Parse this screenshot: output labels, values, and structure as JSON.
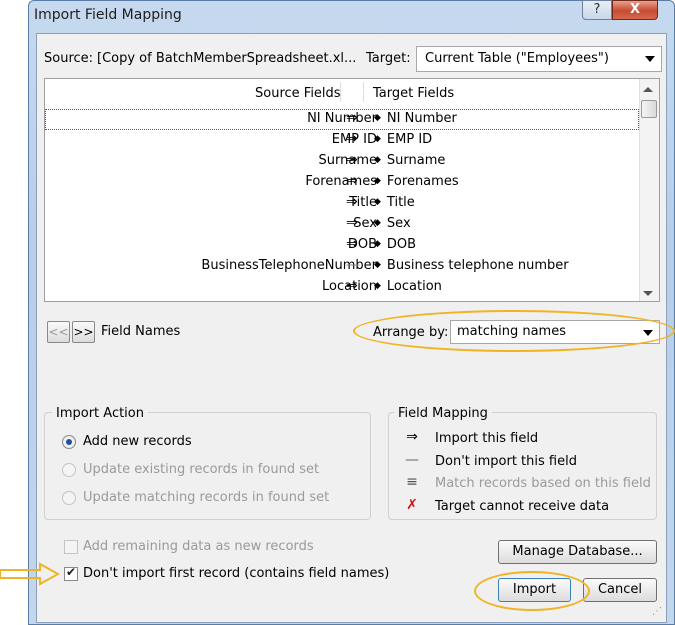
{
  "window": {
    "title": "Import Field Mapping",
    "help_glyph": "?",
    "close_glyph": "X"
  },
  "source": {
    "label": "Source:",
    "value": "[Copy of BatchMemberSpreadsheet.xl..."
  },
  "target": {
    "label": "Target:",
    "value": "Current Table (\"Employees\")"
  },
  "mapping_table": {
    "headers": {
      "source": "Source Fields",
      "target": "Target Fields"
    },
    "rows": [
      {
        "source": "NI Number",
        "symbol": "⇒",
        "target": "NI Number"
      },
      {
        "source": "EMP ID",
        "symbol": "⇒",
        "target": "EMP ID"
      },
      {
        "source": "Surname",
        "symbol": "⇒",
        "target": "Surname"
      },
      {
        "source": "Forenames",
        "symbol": "⇒",
        "target": "Forenames"
      },
      {
        "source": "Title",
        "symbol": "⇒",
        "target": "Title"
      },
      {
        "source": "Sex",
        "symbol": "⇒",
        "target": "Sex"
      },
      {
        "source": "DOB",
        "symbol": "⇒",
        "target": "DOB"
      },
      {
        "source": "BusinessTelephoneNumber",
        "symbol": "—",
        "target": "Business telephone number"
      },
      {
        "source": "Location",
        "symbol": "⇒",
        "target": "Location"
      }
    ],
    "updown_glyph": "◆"
  },
  "navigation": {
    "prev": "<<",
    "next": ">>",
    "label": "Field Names"
  },
  "arrange": {
    "label": "Arrange by:",
    "value": "matching names"
  },
  "import_action": {
    "title": "Import Action",
    "options": [
      {
        "label": "Add new records",
        "selected": true,
        "enabled": true
      },
      {
        "label": "Update existing records in found set",
        "selected": false,
        "enabled": false
      },
      {
        "label": "Update matching records in found set",
        "selected": false,
        "enabled": false
      }
    ]
  },
  "field_mapping_legend": {
    "title": "Field Mapping",
    "items": [
      {
        "symbol": "⇒",
        "label": "Import this field",
        "enabled": true
      },
      {
        "symbol": "—",
        "label": "Don't import this field",
        "enabled": true
      },
      {
        "symbol": "≡",
        "label": "Match records based on this field",
        "enabled": false
      },
      {
        "symbol": "✗",
        "label": "Target cannot receive data",
        "enabled": true
      }
    ]
  },
  "checkboxes": {
    "add_remaining": {
      "label": "Add remaining data as new records",
      "checked": false,
      "enabled": false
    },
    "dont_import_first": {
      "label": "Don't import first record (contains field names)",
      "checked": true,
      "enabled": true
    }
  },
  "buttons": {
    "manage": "Manage Database...",
    "import": "Import",
    "cancel": "Cancel"
  },
  "colors": {
    "highlight": "#f0b323",
    "frame": "#b7cde8",
    "radio_dot": "#1f4fa1",
    "error_x": "#d0121b"
  }
}
